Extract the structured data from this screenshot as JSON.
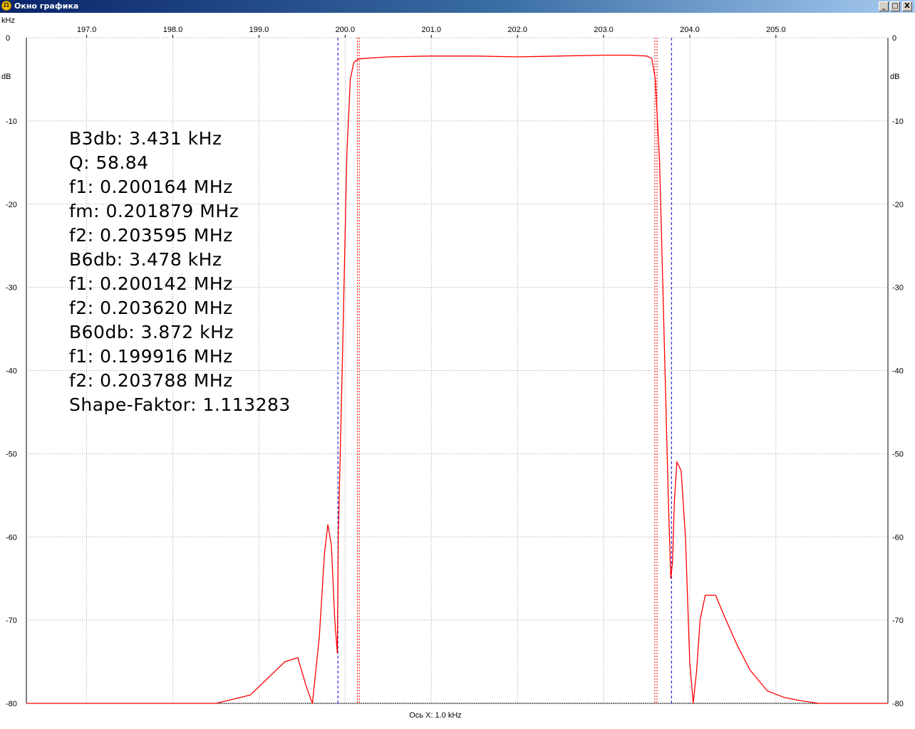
{
  "window": {
    "title": "Окно графика",
    "app_icon": "spectrum-app-icon"
  },
  "controls": {
    "minimize": "_",
    "maximize": "□",
    "close": "X"
  },
  "axes": {
    "x_unit": "kHz",
    "y_unit": "dB",
    "x_caption": "Ось X: 1.0 kHz",
    "x_range": [
      196.3,
      206.3
    ],
    "y_range": [
      -80,
      0
    ],
    "x_ticks": [
      197.0,
      198.0,
      199.0,
      200.0,
      201.0,
      202.0,
      203.0,
      204.0,
      205.0
    ],
    "y_ticks": [
      0,
      -10,
      -20,
      -30,
      -40,
      -50,
      -60,
      -70,
      -80
    ]
  },
  "readout": [
    "B3db: 3.431 kHz",
    "Q: 58.84",
    "f1: 0.200164 MHz",
    "fm: 0.201879 MHz",
    "f2: 0.203595 MHz",
    "B6db: 3.478 kHz",
    "f1: 0.200142 MHz",
    "f2: 0.203620 MHz",
    "B60db: 3.872 kHz",
    "f1: 0.199916 MHz",
    "f2: 0.203788 MHz",
    "Shape-Faktor: 1.113283"
  ],
  "colors": {
    "trace": "#ff0000",
    "marker_3db": "#ff0000",
    "marker_60db": "#0000cc",
    "grid": "#a0a0a0"
  },
  "chart_data": {
    "type": "line",
    "title": "",
    "xlabel": "Ось X: 1.0 kHz",
    "ylabel": "dB",
    "xlim": [
      196.3,
      206.3
    ],
    "ylim": [
      -80,
      0
    ],
    "grid": true,
    "series": [
      {
        "x": [
          196.3,
          197.0,
          197.5,
          198.0,
          198.5,
          198.9,
          199.1,
          199.3,
          199.45,
          199.55,
          199.62,
          199.7,
          199.76,
          199.8,
          199.84,
          199.88,
          199.91,
          199.92,
          199.97,
          200.02,
          200.06,
          200.1,
          200.12,
          200.15,
          200.2,
          200.5,
          201.0,
          201.5,
          202.0,
          202.5,
          203.0,
          203.3,
          203.5,
          203.56,
          203.6,
          203.65,
          203.7,
          203.75,
          203.78,
          203.8,
          203.82,
          203.85,
          203.9,
          203.95,
          204.0,
          204.04,
          204.08,
          204.12,
          204.18,
          204.3,
          204.4,
          204.55,
          204.7,
          204.9,
          205.1,
          205.3,
          205.5,
          205.8,
          206.3
        ],
        "y": [
          -80,
          -80,
          -80,
          -80,
          -80,
          -79,
          -77,
          -75,
          -74.5,
          -78,
          -80,
          -72,
          -62,
          -58.5,
          -61,
          -70,
          -74,
          -60,
          -38,
          -14,
          -5,
          -3,
          -2.8,
          -2.6,
          -2.5,
          -2.3,
          -2.2,
          -2.2,
          -2.3,
          -2.2,
          -2.1,
          -2.1,
          -2.2,
          -2.5,
          -5,
          -15,
          -35,
          -55,
          -65,
          -63,
          -56,
          -51,
          -52,
          -60,
          -75,
          -80,
          -76,
          -70,
          -67,
          -67,
          -69.5,
          -73,
          -76,
          -78.5,
          -79.3,
          -79.7,
          -80,
          -80,
          -80
        ]
      }
    ],
    "markers": [
      {
        "x": 199.916,
        "style": "blue-dashed"
      },
      {
        "x": 200.142,
        "style": "red-dotted"
      },
      {
        "x": 200.164,
        "style": "red-dotted"
      },
      {
        "x": 203.595,
        "style": "red-dotted"
      },
      {
        "x": 203.62,
        "style": "red-dotted"
      },
      {
        "x": 203.788,
        "style": "blue-dashed"
      }
    ]
  }
}
